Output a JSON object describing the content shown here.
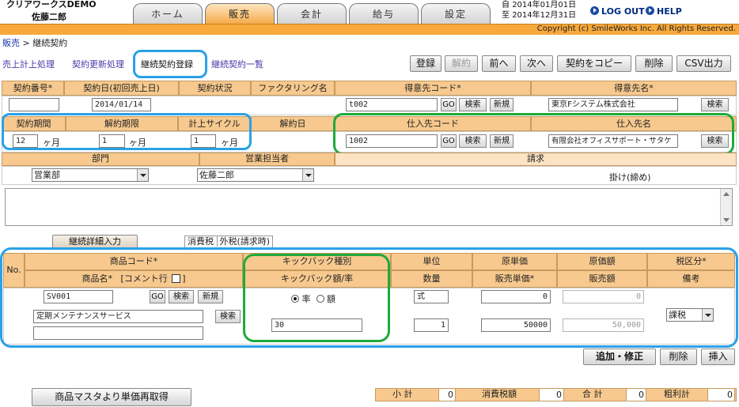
{
  "header": {
    "app_name": "クリアワークスDEMO",
    "user_name": "佐藤二郎",
    "tabs": [
      "ホーム",
      "販売",
      "会計",
      "給与",
      "設定"
    ],
    "date_from_label": "自",
    "date_from": "2014年01月01日",
    "date_to_label": "至",
    "date_to": "2014年12月31日",
    "logout": "LOG OUT",
    "help": "HELP",
    "copyright": "Copyright (c) SmileWorks Inc. All Rights Reserved."
  },
  "breadcrumb": {
    "root": "販売",
    "separator": " > ",
    "current": "継続契約"
  },
  "subnav": [
    "売上計上処理",
    "契約更新処理",
    "継続契約登録",
    "継続契約一覧"
  ],
  "toolbar": [
    "登録",
    "解約",
    "前へ",
    "次へ",
    "契約をコピー",
    "削除",
    "CSV出力"
  ],
  "contract": {
    "headers1": [
      "契約番号*",
      "契約日(初回売上日)",
      "契約状況",
      "ファクタリング名",
      "得意先コード*",
      "得意先名*"
    ],
    "contract_no": "",
    "contract_date": "2014/01/14",
    "customer_code": "t002",
    "customer_name": "東京Fシステム株式会社",
    "headers2": [
      "契約期間",
      "解約期限",
      "計上サイクル",
      "解約日",
      "仕入先コード",
      "仕入先名"
    ],
    "period": "12",
    "cancel_limit": "1",
    "cycle": "1",
    "month_unit": "ヶ月",
    "supplier_code": "1002",
    "supplier_name": "有限会社オフィスサポート・サタケ",
    "headers3": [
      "部門",
      "営業担当者",
      "請求"
    ],
    "department": "営業部",
    "sales_rep": "佐藤二郎",
    "billing": "掛け(締め)",
    "go": "GO",
    "search": "検索",
    "new": "新規"
  },
  "detail": {
    "tab_button": "継続詳細入力",
    "tax_label": "消費税",
    "tax_value": "外税(請求時)",
    "no": "No.",
    "h_product_code": "商品コード*",
    "h_product_name": "商品名*",
    "h_comment": "[コメント行",
    "h_kickback_type": "キックバック種別",
    "h_kickback_amount": "キックバック額/率",
    "h_unit": "単位",
    "h_qty": "数量",
    "h_unit_cost": "原単価",
    "h_sale_price": "販売単価*",
    "h_cost_amount": "原価額",
    "h_sales_amount": "販売額",
    "h_tax_class": "税区分*",
    "h_note": "備考",
    "product_code": "SV001",
    "product_name": "定期メンテナンスサービス",
    "radio_rate": "率",
    "radio_amount": "額",
    "kickback_value": "30",
    "unit": "式",
    "qty": "1",
    "unit_cost": "0",
    "cost_amount": "0",
    "sale_price": "50000",
    "sales_amount": "50,000",
    "tax_class": "課税"
  },
  "actions": [
    "追加・修正",
    "削除",
    "挿入"
  ],
  "refetch": "商品マスタより単価再取得",
  "totals": [
    {
      "label": "小 計",
      "value": "0"
    },
    {
      "label": "消費税額",
      "value": "0"
    },
    {
      "label": "合 計",
      "value": "0"
    },
    {
      "label": "粗利計",
      "value": "0"
    }
  ]
}
